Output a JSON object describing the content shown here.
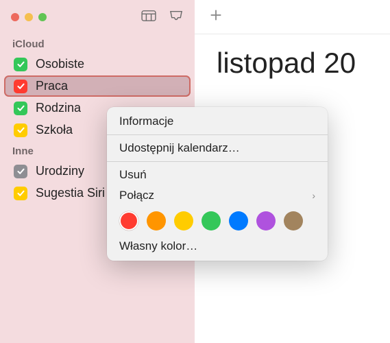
{
  "traffic": {
    "close": "#ED6A5E",
    "min": "#F5BF4F",
    "max": "#61C454"
  },
  "sidebar": {
    "sections": [
      {
        "title": "iCloud",
        "items": [
          {
            "label": "Osobiste",
            "color": "#34C759",
            "checked": true,
            "selected": false
          },
          {
            "label": "Praca",
            "color": "#FF3B30",
            "checked": true,
            "selected": true
          },
          {
            "label": "Rodzina",
            "color": "#34C759",
            "checked": true,
            "selected": false
          },
          {
            "label": "Szkoła",
            "color": "#FFCC00",
            "checked": true,
            "selected": false
          }
        ]
      },
      {
        "title": "Inne",
        "items": [
          {
            "label": "Urodziny",
            "color": "#8E8E93",
            "checked": true,
            "selected": false
          },
          {
            "label": "Sugestia Siri",
            "color": "#FFCC00",
            "checked": true,
            "selected": false
          }
        ]
      }
    ]
  },
  "main": {
    "title": "listopad 20"
  },
  "contextMenu": {
    "items": [
      {
        "label": "Informacje",
        "submenu": false
      },
      "sep",
      {
        "label": "Udostępnij kalendarz…",
        "submenu": false
      },
      "sep",
      {
        "label": "Usuń",
        "submenu": false
      },
      {
        "label": "Połącz",
        "submenu": true
      },
      "colors",
      {
        "label": "Własny kolor…",
        "submenu": false
      }
    ],
    "colors": [
      {
        "hex": "#FF3B30",
        "selected": true
      },
      {
        "hex": "#FF9500",
        "selected": false
      },
      {
        "hex": "#FFCC00",
        "selected": false
      },
      {
        "hex": "#34C759",
        "selected": false
      },
      {
        "hex": "#007AFF",
        "selected": false
      },
      {
        "hex": "#AF52DE",
        "selected": false
      },
      {
        "hex": "#A2845E",
        "selected": false
      }
    ]
  }
}
